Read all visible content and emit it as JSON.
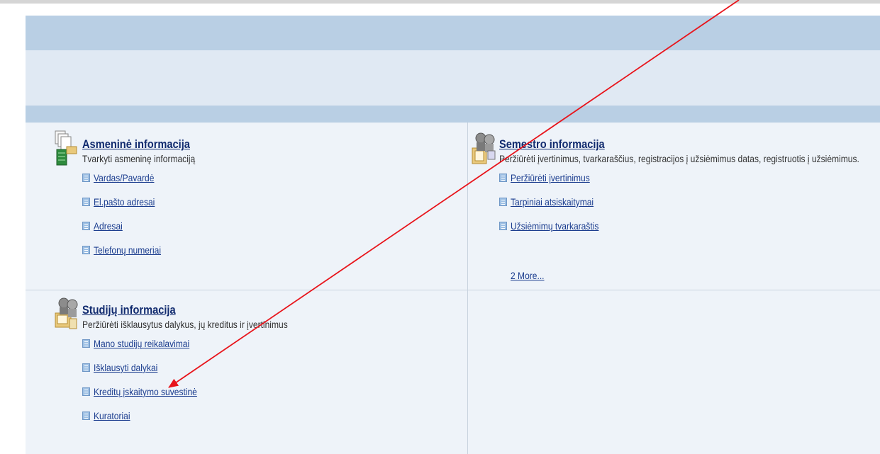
{
  "sections": {
    "personal": {
      "title": "Asmeninė informacija",
      "description": "Tvarkyti asmeninę informaciją",
      "links": [
        "Vardas/Pavardė",
        "El.pašto adresai",
        "Adresai",
        "Telefonų numeriai"
      ]
    },
    "semester": {
      "title": "Semestro informacija",
      "description": "Peržiūrėti įvertinimus, tvarkaraščius, registracijos į užsiėmimus datas, registruotis į užsiėmimus.",
      "links": [
        "Peržiūrėti įvertinimus",
        "Tarpiniai atsiskaitymai",
        "Užsiėmimų tvarkaraštis"
      ],
      "more": "2 More..."
    },
    "studies": {
      "title": "Studijų informacija",
      "description": "Peržiūrėti išklausytus dalykus, jų kreditus ir įvertinimus",
      "links": [
        "Mano studijų reikalavimai",
        "Išklausyti dalykai",
        "Kreditų įskaitymo suvestinė",
        "Kuratoriai"
      ]
    }
  },
  "annotation": {
    "arrow_color": "#e8141b"
  },
  "colors": {
    "band_dark": "#b9cfe4",
    "band_light": "#e0e9f3",
    "content_bg": "#eef3f9",
    "link": "#1a3c8e"
  }
}
